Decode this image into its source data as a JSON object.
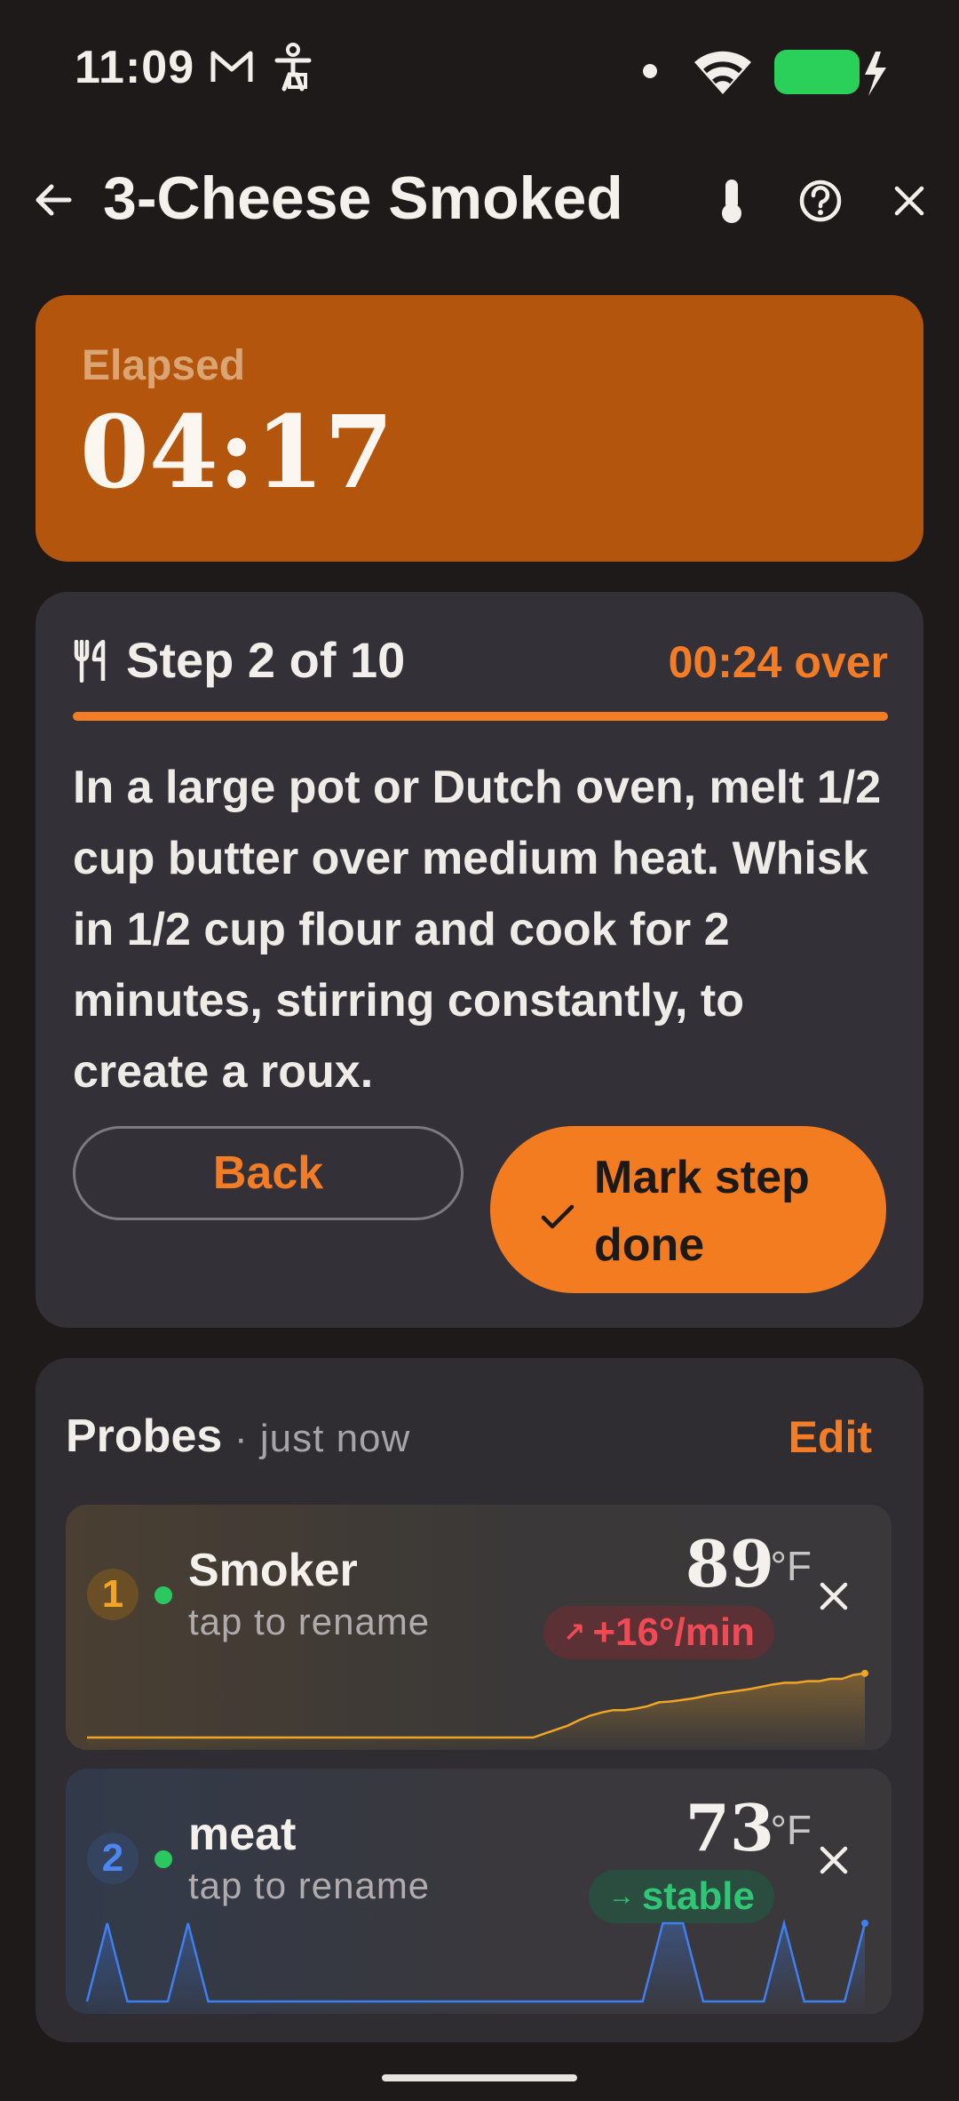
{
  "status_bar": {
    "time": "11:09",
    "icons": [
      "gmail-icon",
      "accessibility-icon",
      "dot-icon",
      "wifi-icon",
      "battery-charging-icon"
    ],
    "battery_color": "#2bd05a"
  },
  "header": {
    "title": "3-Cheese Smoked",
    "icons": [
      "back-arrow-icon",
      "thermometer-icon",
      "help-icon",
      "close-icon"
    ]
  },
  "timer": {
    "label": "Elapsed",
    "value": "04:17",
    "background": "#b3550c"
  },
  "step": {
    "title": "Step 2 of 10",
    "status": "00:24 over",
    "progress": 1.0,
    "instruction": "In a large pot or Dutch oven, melt 1/2 cup butter over medium heat. Whisk in 1/2 cup flour and cook for 2 minutes, stirring constantly, to create a roux.",
    "back_label": "Back",
    "done_label": "Mark step done",
    "accent": "#f47c24"
  },
  "probes": {
    "title": "Probes",
    "updated": "· just now",
    "edit_label": "Edit",
    "items": [
      {
        "number": "1",
        "name": "Smoker",
        "hint": "tap to rename",
        "temp": "89",
        "unit": "°F",
        "trend_icon": "↗",
        "trend": "+16°/min",
        "trend_color": "#f04b55",
        "line_color": "#f0a624",
        "history": [
          0,
          0,
          0,
          0,
          0,
          0,
          0,
          0,
          0,
          0,
          0,
          0,
          0,
          0,
          0,
          0,
          0,
          0,
          0,
          0,
          0,
          0,
          0,
          0,
          0,
          0,
          0,
          0,
          0,
          0,
          0,
          0,
          0,
          0,
          0,
          0,
          0,
          0,
          0,
          0,
          0.05,
          0.1,
          0.15,
          0.22,
          0.28,
          0.32,
          0.35,
          0.35,
          0.37,
          0.4,
          0.45,
          0.46,
          0.48,
          0.5,
          0.53,
          0.56,
          0.58,
          0.6,
          0.62,
          0.65,
          0.68,
          0.7,
          0.7,
          0.72,
          0.72,
          0.75,
          0.75,
          0.8,
          0.82
        ]
      },
      {
        "number": "2",
        "name": "meat",
        "hint": "tap to rename",
        "temp": "73",
        "unit": "°F",
        "trend_icon": "→",
        "trend": "stable",
        "trend_color": "#2fc775",
        "line_color": "#3f7ff0",
        "history": [
          0,
          0.5,
          1,
          0.5,
          0,
          0,
          0,
          0,
          0,
          0.5,
          1,
          0.5,
          0,
          0,
          0,
          0,
          0,
          0,
          0,
          0,
          0,
          0,
          0,
          0,
          0,
          0,
          0,
          0,
          0,
          0,
          0,
          0,
          0,
          0,
          0,
          0,
          0,
          0,
          0,
          0,
          0,
          0,
          0,
          0,
          0,
          0,
          0,
          0,
          0,
          0,
          0,
          0,
          0,
          0,
          0,
          0,
          0.5,
          1,
          1,
          1,
          0.5,
          0,
          0,
          0,
          0,
          0,
          0,
          0,
          0.5,
          1,
          0.5,
          0,
          0,
          0,
          0,
          0,
          0.5,
          1
        ]
      }
    ]
  }
}
